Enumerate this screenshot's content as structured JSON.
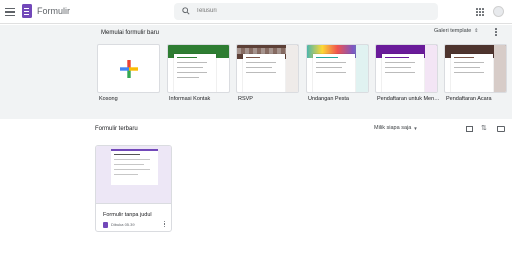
{
  "header": {
    "app_title": "Formulir",
    "search_placeholder": "Telusuri",
    "brand_color": "#7248b9"
  },
  "gallery": {
    "title": "Memulai formulir baru",
    "toggle_label": "Galeri template",
    "templates": [
      {
        "label": "Kosong",
        "icon": "colored-plus-icon"
      },
      {
        "label": "Informasi Kontak",
        "accent": "#2e7d32"
      },
      {
        "label": "RSVP",
        "accent": "#8d6e63"
      },
      {
        "label": "Undangan Pesta",
        "accent": "#26a69a"
      },
      {
        "label": "Pendaftaran untuk Men…",
        "accent": "#6a1b9a"
      },
      {
        "label": "Pendaftaran Acara",
        "accent": "#795548"
      }
    ]
  },
  "recent": {
    "title": "Formulir terbaru",
    "owner_filter": "Milik siapa saja",
    "forms": [
      {
        "title": "Formulir tanpa judul",
        "meta": "Dibuka 05.39"
      }
    ]
  }
}
